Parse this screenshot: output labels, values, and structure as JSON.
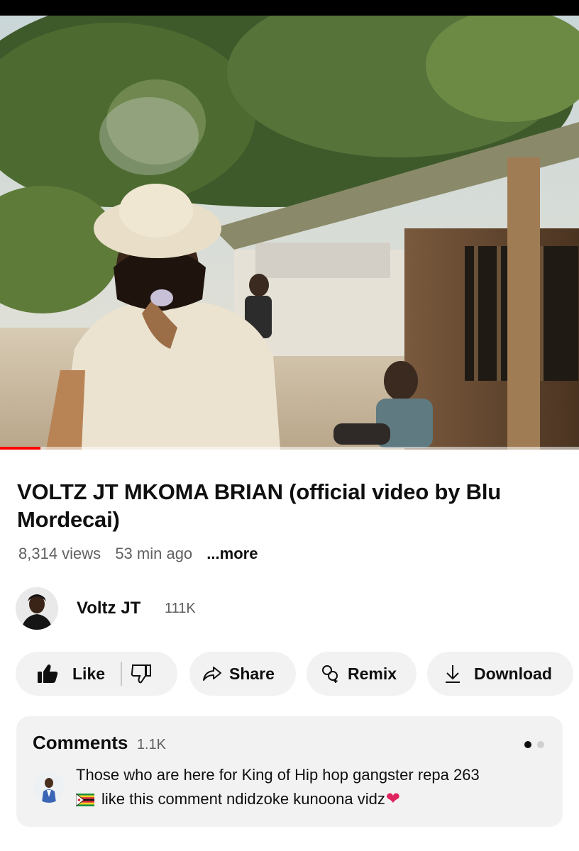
{
  "video": {
    "title": "VOLTZ JT MKOMA BRIAN (official video by Blu Mordecai)",
    "views": "8,314 views",
    "age": "53 min ago",
    "more_label": "...more",
    "progress_fraction": 0.07
  },
  "channel": {
    "name": "Voltz JT",
    "subscribers": "111K"
  },
  "actions": {
    "like_label": "Like",
    "share_label": "Share",
    "remix_label": "Remix",
    "download_label": "Download"
  },
  "comments": {
    "title": "Comments",
    "count": "1.1K",
    "top_comment": {
      "line1": "Those who are here for King of Hip hop gangster repa 263",
      "line2": "like this comment ndidzoke kunoona vidz"
    }
  },
  "icons": {
    "like": "thumbs-up-icon",
    "dislike": "thumbs-down-icon",
    "share": "share-arrow-icon",
    "remix": "remix-icon",
    "download": "download-icon",
    "flag": "zimbabwe-flag-emoji",
    "heart": "red-heart-emoji"
  },
  "colors": {
    "progress": "#ff0000",
    "pill_background": "#f2f2f2",
    "secondary_text": "#606060",
    "heart": "#e0245e"
  }
}
